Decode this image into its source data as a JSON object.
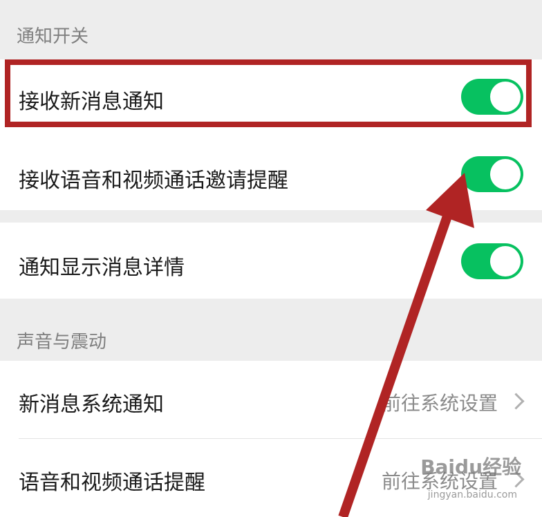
{
  "sections": {
    "notify_header": "通知开关",
    "sound_header": "声音与震动"
  },
  "rows": {
    "new_message": {
      "label": "接收新消息通知",
      "enabled": true
    },
    "call_invite": {
      "label": "接收语音和视频通话邀请提醒",
      "enabled": true
    },
    "show_detail": {
      "label": "通知显示消息详情",
      "enabled": true
    },
    "system_notify": {
      "label": "新消息系统通知",
      "value": "前往系统设置"
    },
    "call_remind": {
      "label": "语音和视频通话提醒",
      "value": "前往系统设置"
    }
  },
  "annotation": {
    "highlight_color": "#b02424",
    "arrow_color": "#b02424"
  },
  "watermark": {
    "brand": "Baidu经验",
    "url": "jingyan.baidu.com"
  },
  "colors": {
    "toggle_on": "#07c160",
    "background": "#ededed"
  }
}
